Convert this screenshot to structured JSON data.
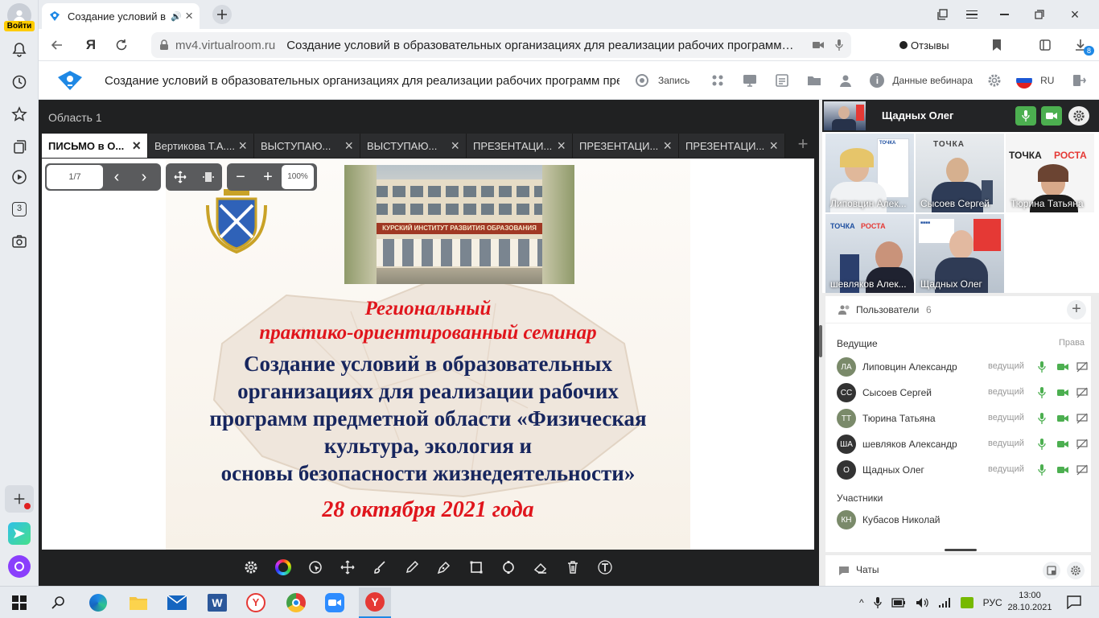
{
  "sidebar": {
    "login_label": "Войти",
    "items": [
      {
        "icon": "bell-icon"
      },
      {
        "icon": "history-icon"
      },
      {
        "icon": "star-icon"
      },
      {
        "icon": "collections-icon"
      },
      {
        "icon": "play-icon"
      },
      {
        "icon": "three-icon",
        "text": "3"
      },
      {
        "icon": "camera-icon"
      }
    ]
  },
  "browser": {
    "tab_title": "Создание условий в",
    "domain": "mv4.virtualroom.ru",
    "page_title": "Создание условий в образовательных организациях для реализации рабочих программ…",
    "feedback_label": "Отзывы",
    "download_badge": "8"
  },
  "app": {
    "title": "Создание условий в образовательных организациях для реализации рабочих программ пре…",
    "record_label": "Запись",
    "webinar_data_label": "Данные вебинара",
    "lang": "RU"
  },
  "stage": {
    "area_label": "Область 1",
    "tabs": [
      {
        "label": "ПИСЬМО в О...",
        "active": true
      },
      {
        "label": "Вертикова Т.А...."
      },
      {
        "label": "ВЫСТУПАЮ..."
      },
      {
        "label": "ВЫСТУПАЮ..."
      },
      {
        "label": "ПРЕЗЕНТАЦИ..."
      },
      {
        "label": "ПРЕЗЕНТАЦИ..."
      },
      {
        "label": "ПРЕЗЕНТАЦИ..."
      }
    ],
    "page_counter": "1/7",
    "zoom": "100%"
  },
  "slide": {
    "building_sign": "КУРСКИЙ ИНСТИТУТ РАЗВИТИЯ ОБРАЗОВАНИЯ",
    "line1": "Региональный",
    "line2": "практико-ориентированный семинар",
    "line3": "Создание условий в образовательных",
    "line4": "организациях для реализации рабочих",
    "line5": "программ предметной области «Физическая",
    "line6": "культура, экология и",
    "line7": "основы безопасности жизнедеятельности»",
    "date": "28 октября 2021 года",
    "red": "#e0151c",
    "navy": "#17265e"
  },
  "video": {
    "speaker_name": "Щадных Олег",
    "tiles": [
      {
        "name": "Липовцин Алек..."
      },
      {
        "name": "Сысоев Сергей"
      },
      {
        "name": "Тюрина Татьяна"
      },
      {
        "name": "шевляков Алек..."
      },
      {
        "name": "Щадных Олег"
      }
    ],
    "sign_text_1": "ТОЧКА",
    "sign_text_2": "РОСТА"
  },
  "users": {
    "title": "Пользователи",
    "count": "6",
    "hosts_title": "Ведущие",
    "rights_label": "Права",
    "hosts": [
      {
        "initials": "ЛА",
        "name": "Липовцин Александр",
        "role": "ведущий"
      },
      {
        "initials": "СС",
        "name": "Сысоев Сергей",
        "role": "ведущий"
      },
      {
        "initials": "ТТ",
        "name": "Тюрина Татьяна",
        "role": "ведущий"
      },
      {
        "initials": "ША",
        "name": "шевляков Александр",
        "role": "ведущий"
      },
      {
        "initials": "О",
        "name": "Щадных Олег",
        "role": "ведущий"
      }
    ],
    "participants_title": "Участники",
    "participants": [
      {
        "initials": "КН",
        "name": "Кубасов Николай"
      }
    ],
    "chats_label": "Чаты"
  },
  "taskbar": {
    "lang": "РУС",
    "time": "13:00",
    "date": "28.10.2021"
  },
  "colors": {
    "accent": "#1e88e5",
    "green": "#4caf50",
    "dark_bg": "#202122",
    "avatar_grey": "#7a8a6a",
    "avatar_dark": "#333333"
  }
}
